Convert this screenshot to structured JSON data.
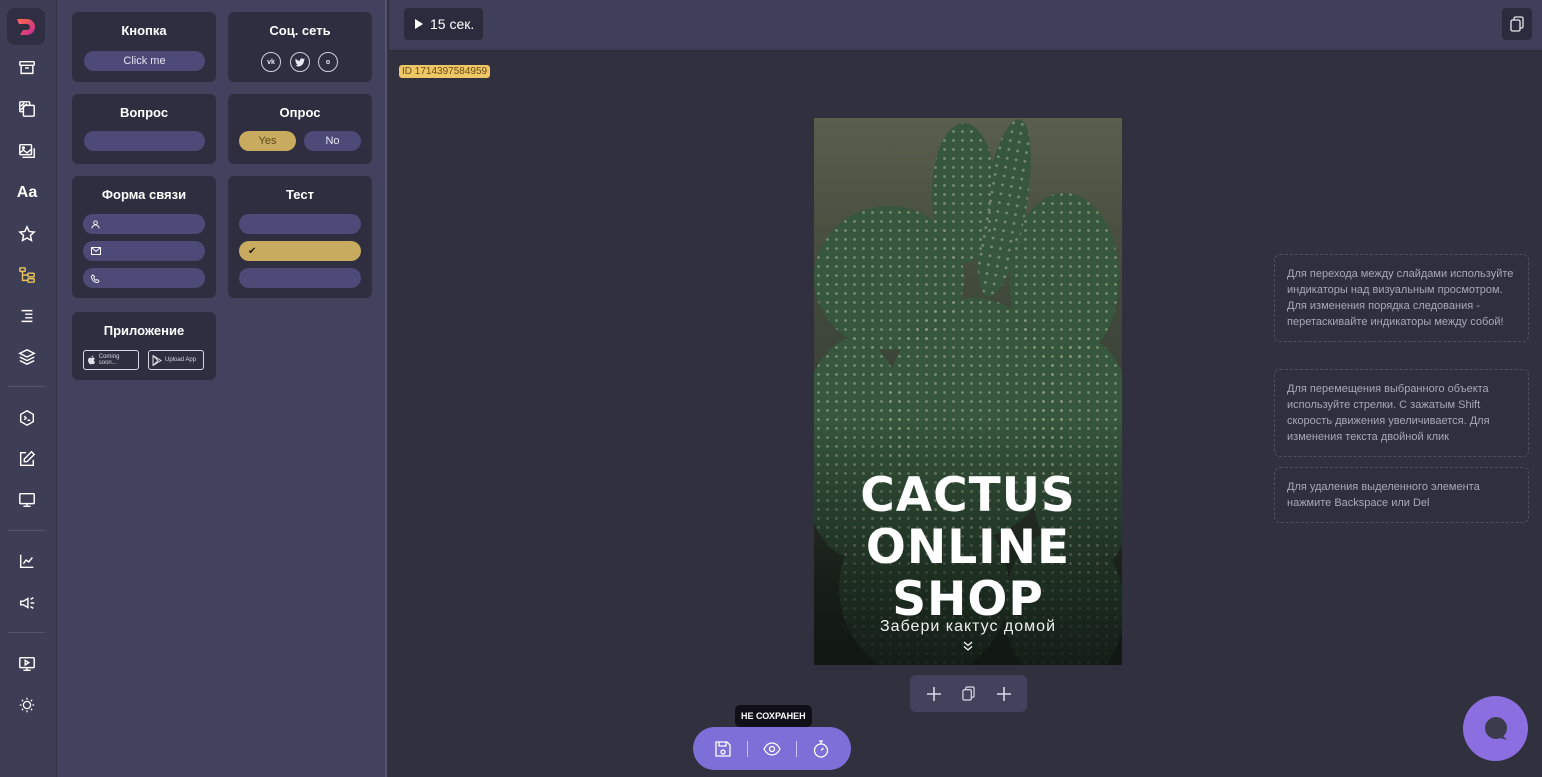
{
  "rail": {
    "items": [
      {
        "name": "archive",
        "icon": "archive-icon"
      },
      {
        "name": "backgrounds",
        "icon": "layers-pattern-icon"
      },
      {
        "name": "images",
        "icon": "images-icon"
      },
      {
        "name": "text",
        "icon": "text-icon",
        "label": "Aa"
      },
      {
        "name": "stickers",
        "icon": "star-icon"
      },
      {
        "name": "widgets",
        "icon": "tree-icon",
        "active": true
      },
      {
        "name": "align",
        "icon": "align-right-icon"
      },
      {
        "name": "layers",
        "icon": "stack-icon"
      },
      {
        "name": "code",
        "icon": "code-icon"
      },
      {
        "name": "edit",
        "icon": "edit-icon"
      },
      {
        "name": "preview",
        "icon": "monitor-icon"
      },
      {
        "name": "analytics",
        "icon": "chart-icon"
      },
      {
        "name": "promo",
        "icon": "megaphone-icon"
      },
      {
        "name": "presentation",
        "icon": "play-screen-icon"
      },
      {
        "name": "theme",
        "icon": "sun-icon"
      }
    ],
    "active_color": "#e9c35a"
  },
  "widgets": {
    "button": {
      "title": "Кнопка",
      "label": "Click me"
    },
    "social": {
      "title": "Соц. сеть",
      "icons": [
        "vk",
        "twitter",
        "ok"
      ]
    },
    "question": {
      "title": "Вопрос"
    },
    "poll": {
      "title": "Опрос",
      "yes": "Yes",
      "no": "No"
    },
    "form": {
      "title": "Форма связи",
      "fields": [
        "user-icon",
        "mail-icon",
        "phone-icon"
      ]
    },
    "test": {
      "title": "Тест",
      "check": "✔"
    },
    "app": {
      "title": "Приложение",
      "apple": "Coming soon...",
      "google": "Upload App"
    }
  },
  "topbar": {
    "duration": "15 сек."
  },
  "slide": {
    "id": "ID 1714397584959",
    "title_line1": "CACTUS",
    "title_line2": "ONLINE",
    "title_line3": "SHOP",
    "subtitle": "Забери кактус домой"
  },
  "hints": [
    "Для перехода между слайдами используйте индикаторы над визуальным просмотром. Для изменения порядка следования - перетаскивайте индикаторы между собой!",
    "Для перемещения выбранного объекта используйте стрелки. С зажатым Shift скорость движения увеличивается. Для изменения текста двойной клик",
    "Для удаления выделенного элемента нажмите Backspace или Del"
  ],
  "toolbar": {
    "tooltip": "НЕ СОХРАНЕН"
  },
  "colors": {
    "accent": "#7c6fd8",
    "gold": "#c9ab60",
    "id_tag": "#f0c766"
  }
}
